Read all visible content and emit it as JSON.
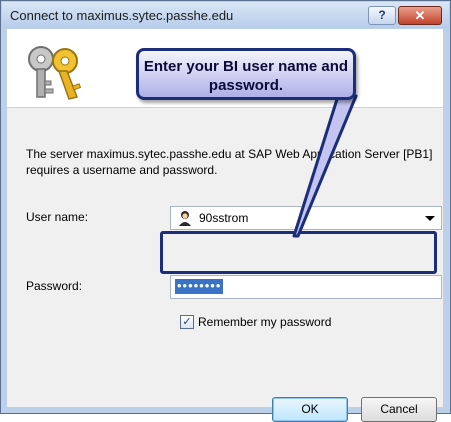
{
  "window": {
    "title": "Connect to maximus.sytec.passhe.edu",
    "help_glyph": "?",
    "close_glyph": "✕"
  },
  "callout": {
    "text": "Enter your BI user name and password."
  },
  "description": "The server maximus.sytec.passhe.edu at SAP Web Application Server [PB1] requires a username and password.",
  "username": {
    "label": "User name:",
    "value": "90sstrom",
    "icon": "user-icon"
  },
  "password": {
    "label": "Password:",
    "value": "••••••••"
  },
  "remember": {
    "label": "Remember my password",
    "checked": true,
    "check_glyph": "✓"
  },
  "buttons": {
    "ok": "OK",
    "cancel": "Cancel"
  },
  "colors": {
    "callout_border": "#1b2e7a",
    "selection": "#3a73c6",
    "close_button": "#c2432b"
  }
}
